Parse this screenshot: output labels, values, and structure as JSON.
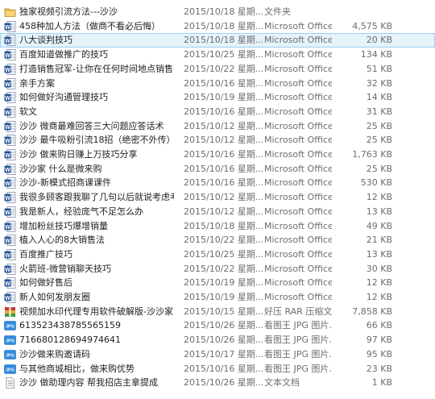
{
  "files": [
    {
      "name": "独家视频引流方法---沙沙",
      "date": "2015/10/18 星期...",
      "type": "文件夹",
      "size": "",
      "icon": "folder-icon"
    },
    {
      "name": "458种加人方法（做商不看必后悔）",
      "date": "2015/10/18 星期...",
      "type": "Microsoft Office...",
      "size": "4,575 KB",
      "icon": "word-doc-icon"
    },
    {
      "name": "八大谈判技巧",
      "date": "2015/10/18 星期...",
      "type": "Microsoft Office...",
      "size": "20 KB",
      "icon": "word-doc-icon"
    },
    {
      "name": "百度知道做推广的技巧",
      "date": "2015/10/25 星期...",
      "type": "Microsoft Office...",
      "size": "134 KB",
      "icon": "word-doc-icon"
    },
    {
      "name": "打造销售冠军-让你在任何时间地点销售...",
      "date": "2015/10/22 星期...",
      "type": "Microsoft Office...",
      "size": "51 KB",
      "icon": "word-doc-icon"
    },
    {
      "name": "亲手方案",
      "date": "2015/10/16 星期...",
      "type": "Microsoft Office...",
      "size": "32 KB",
      "icon": "word-doc-icon"
    },
    {
      "name": "如何做好沟通管理技巧",
      "date": "2015/10/19 星期...",
      "type": "Microsoft Office...",
      "size": "14 KB",
      "icon": "word-doc-icon"
    },
    {
      "name": "软文",
      "date": "2015/10/16 星期...",
      "type": "Microsoft Office...",
      "size": "31 KB",
      "icon": "word-doc-icon"
    },
    {
      "name": "沙沙   微商最难回答三大问题应答话术",
      "date": "2015/10/12 星期...",
      "type": "Microsoft Office...",
      "size": "25 KB",
      "icon": "word-doc-icon"
    },
    {
      "name": "沙沙   最牛吸粉引流18招（绝密不外传）",
      "date": "2015/10/12 星期...",
      "type": "Microsoft Office...",
      "size": "25 KB",
      "icon": "word-doc-icon"
    },
    {
      "name": "沙沙 做来购日赚上万技巧分享",
      "date": "2015/10/16 星期...",
      "type": "Microsoft Office...",
      "size": "1,763 KB",
      "icon": "word-doc-icon"
    },
    {
      "name": "沙沙家 什么是微来购",
      "date": "2015/10/16 星期...",
      "type": "Microsoft Office...",
      "size": "25 KB",
      "icon": "word-doc-icon"
    },
    {
      "name": "沙沙-新模式招商课课件",
      "date": "2015/10/16 星期...",
      "type": "Microsoft Office...",
      "size": "530 KB",
      "icon": "word-doc-icon"
    },
    {
      "name": "我很多顾客跟我聊了几句以后就说考虑考...",
      "date": "2015/10/12 星期...",
      "type": "Microsoft Office...",
      "size": "12 KB",
      "icon": "word-doc-icon"
    },
    {
      "name": "我是新人，经验庞气不足怎么办",
      "date": "2015/10/12 星期...",
      "type": "Microsoft Office...",
      "size": "13 KB",
      "icon": "word-doc-icon"
    },
    {
      "name": "增加粉丝技巧爆增销量",
      "date": "2015/10/18 星期...",
      "type": "Microsoft Office...",
      "size": "49 KB",
      "icon": "word-doc-icon"
    },
    {
      "name": "植入人心的8大销售法",
      "date": "2015/10/22 星期...",
      "type": "Microsoft Office...",
      "size": "21 KB",
      "icon": "word-doc-icon"
    },
    {
      "name": "百度推广技巧",
      "date": "2015/10/25 星期...",
      "type": "Microsoft Office...",
      "size": "13 KB",
      "icon": "word-doc-icon"
    },
    {
      "name": "火箭班-微营销聊天技巧",
      "date": "2015/10/22 星期...",
      "type": "Microsoft Office...",
      "size": "30 KB",
      "icon": "word-doc-icon"
    },
    {
      "name": "如何做好售后",
      "date": "2015/10/19 星期...",
      "type": "Microsoft Office...",
      "size": "12 KB",
      "icon": "word-doc-icon"
    },
    {
      "name": "新人如何发朋友圈",
      "date": "2015/10/19 星期...",
      "type": "Microsoft Office...",
      "size": "12 KB",
      "icon": "word-doc-icon"
    },
    {
      "name": "视频加水印代理专用软件破解版-沙沙家",
      "date": "2015/10/15 星期...",
      "type": "好压 RAR 压缩文件",
      "size": "7,858 KB",
      "icon": "rar-archive-icon"
    },
    {
      "name": "613523438785565159",
      "date": "2015/10/26 星期...",
      "type": "看图王 JPG 图片...",
      "size": "66 KB",
      "icon": "jpg-image-icon"
    },
    {
      "name": "716680128694974641",
      "date": "2015/10/26 星期...",
      "type": "看图王 JPG 图片...",
      "size": "97 KB",
      "icon": "jpg-image-icon"
    },
    {
      "name": "沙沙做来购邀请码",
      "date": "2015/10/17 星期...",
      "type": "看图王 JPG 图片...",
      "size": "95 KB",
      "icon": "jpg-image-icon"
    },
    {
      "name": "与其他商城相比，做来购优势",
      "date": "2015/10/16 星期...",
      "type": "看图王 JPG 图片...",
      "size": "23 KB",
      "icon": "jpg-image-icon"
    },
    {
      "name": "沙沙   做助理内容 帮我招店主拿提成",
      "date": "2015/10/26 星期...",
      "type": "文本文档",
      "size": "1 KB",
      "icon": "text-file-icon"
    }
  ]
}
